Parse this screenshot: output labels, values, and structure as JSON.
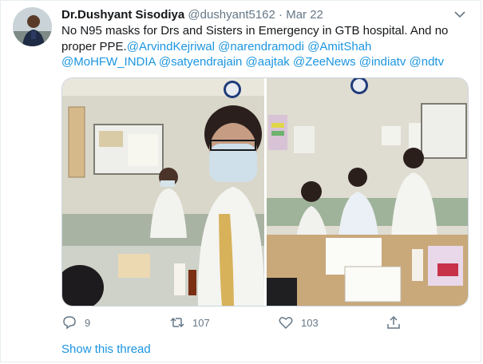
{
  "tweet": {
    "display_name": "Dr.Dushyant Sisodiya",
    "handle": "@dushyant5162",
    "separator": "·",
    "time": "Mar 22",
    "text_plain_1": "No N95 masks for Drs and Sisters in Emergency in GTB hospital. And no proper PPE.",
    "mentions": [
      "@ArvindKejriwal",
      "@narendramodi",
      "@AmitShah",
      "@MoHFW_INDIA",
      "@satyendrajain",
      "@aajtak",
      "@ZeeNews",
      "@indiatv",
      "@ndtv"
    ]
  },
  "actions": {
    "reply_count": "9",
    "retweet_count": "107",
    "like_count": "103"
  },
  "show_thread": "Show this thread",
  "icons": {
    "chevron": "chevron-down-icon",
    "reply": "reply-icon",
    "retweet": "retweet-icon",
    "like": "heart-icon",
    "share": "share-icon"
  },
  "colors": {
    "accent": "#1b95e0",
    "secondary_text": "#657786",
    "border": "#e6ecf0"
  }
}
